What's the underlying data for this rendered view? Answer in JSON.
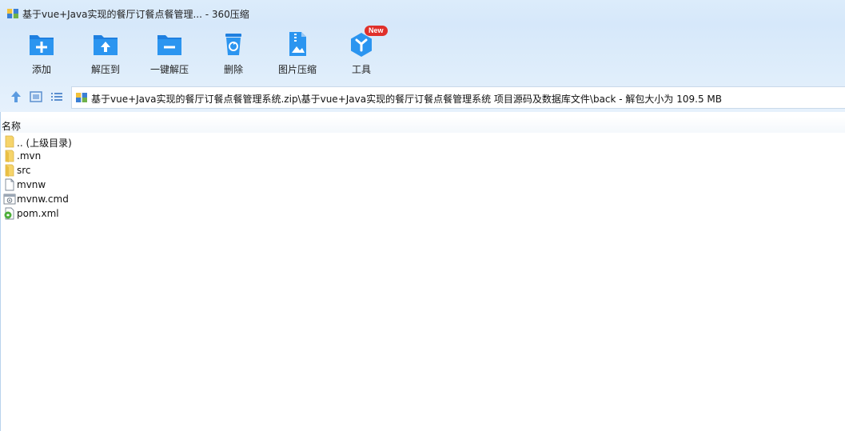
{
  "window": {
    "title": "基于vue+Java实现的餐厅订餐点餐管理... - 360压缩"
  },
  "toolbar": {
    "items": [
      {
        "label": "添加",
        "icon": "add-folder-icon"
      },
      {
        "label": "解压到",
        "icon": "extract-to-folder-icon"
      },
      {
        "label": "一键解压",
        "icon": "one-click-extract-icon"
      },
      {
        "label": "删除",
        "icon": "recycle-bin-icon"
      },
      {
        "label": "图片压缩",
        "icon": "image-compress-icon"
      },
      {
        "label": "工具",
        "icon": "tools-icon",
        "badge": "New"
      }
    ]
  },
  "nav": {
    "path": "基于vue+Java实现的餐厅订餐点餐管理系统.zip\\基于vue+Java实现的餐厅订餐点餐管理系统 项目源码及数据库文件\\back - 解包大小为 109.5 MB"
  },
  "list": {
    "column_name": "名称",
    "files": [
      {
        "name": ".. (上级目录)",
        "icon": "parent-folder-icon"
      },
      {
        "name": ".mvn",
        "icon": "folder-icon"
      },
      {
        "name": "src",
        "icon": "folder-icon"
      },
      {
        "name": "mvnw",
        "icon": "file-icon"
      },
      {
        "name": "mvnw.cmd",
        "icon": "cmd-file-icon"
      },
      {
        "name": "pom.xml",
        "icon": "xml-file-icon"
      }
    ]
  },
  "colors": {
    "accent": "#1e88e5",
    "badge": "#e0302a",
    "folder": "#f6d46a"
  }
}
